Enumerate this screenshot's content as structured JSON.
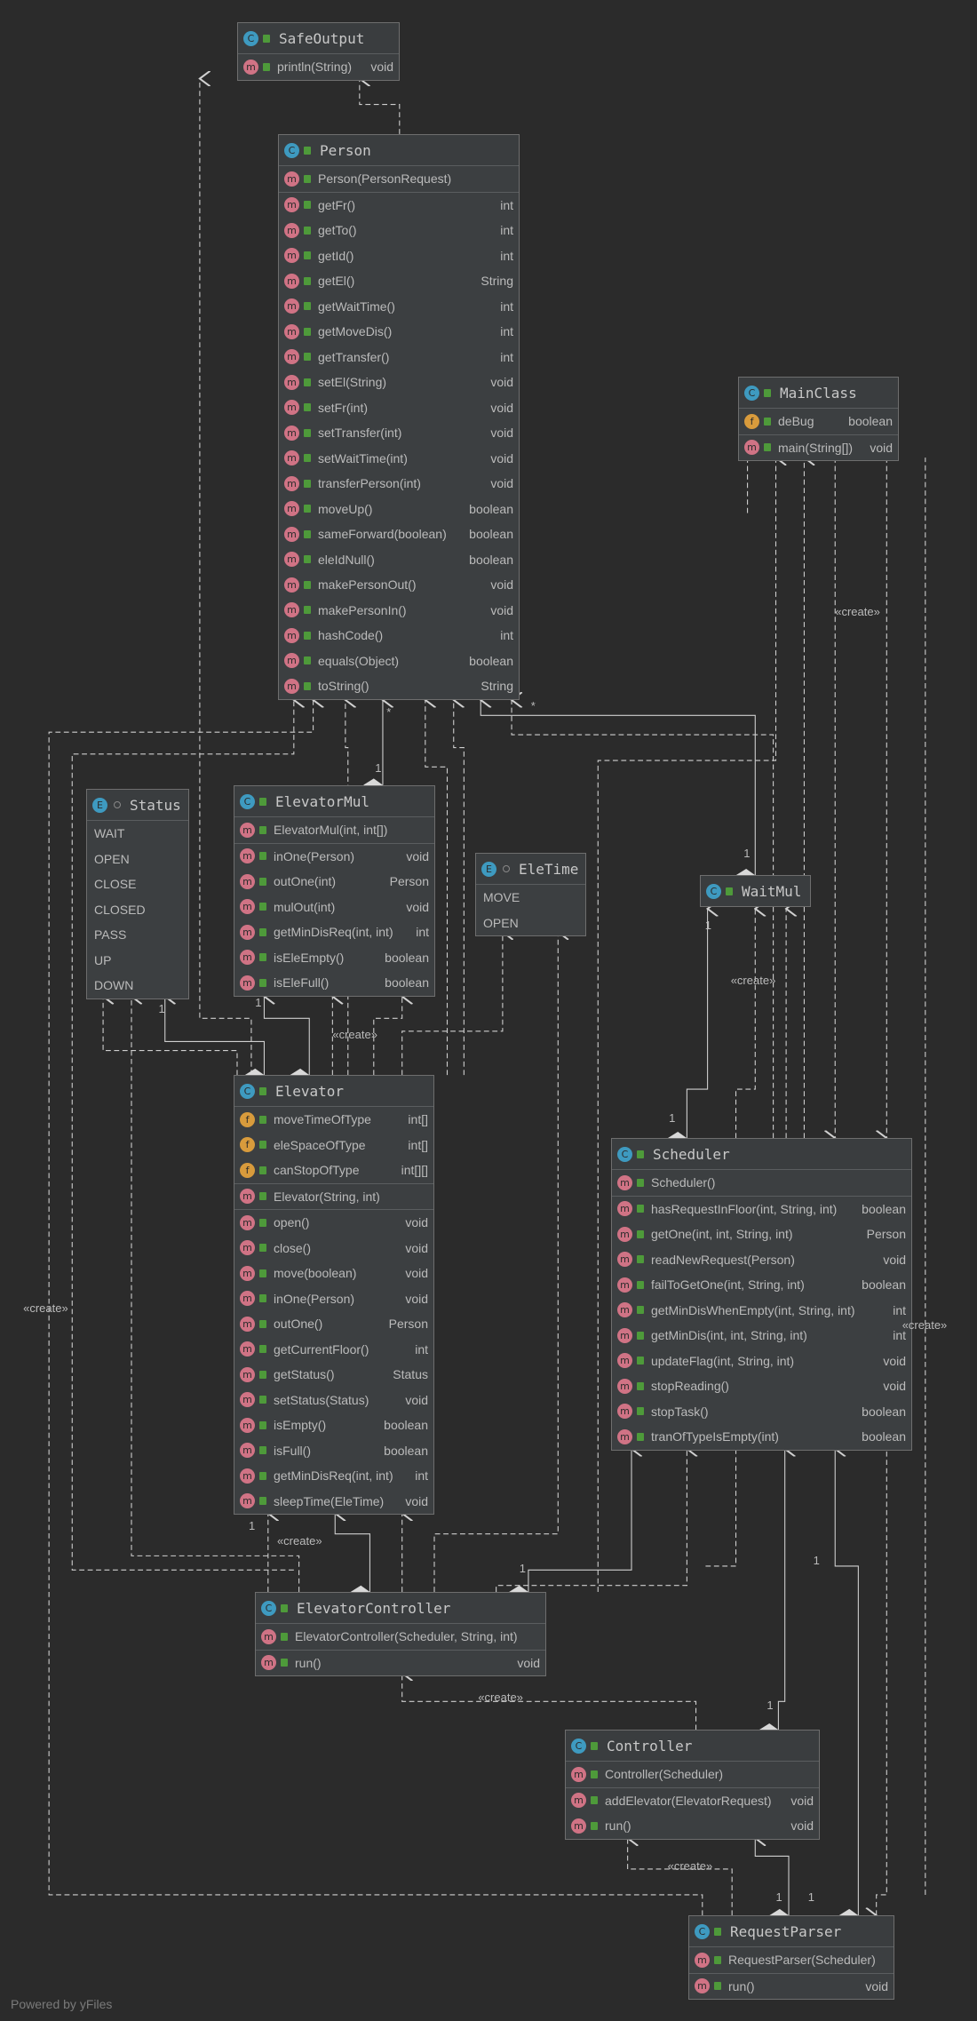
{
  "footer": "Powered by yFiles",
  "colors": {
    "background": "#2b2b2b",
    "box": "#3c3f41",
    "class_icon": "#3e9ac0",
    "method_icon": "#d07385",
    "field_icon": "#d89b3c",
    "public_lock": "#4e9a3a"
  },
  "classes": [
    {
      "name": "SafeOutput",
      "kind": "class",
      "sections": [
        [
          [
            "m",
            "println(String)",
            "void"
          ]
        ]
      ]
    },
    {
      "name": "Person",
      "kind": "class",
      "sections": [
        [
          [
            "m",
            "Person(PersonRequest)",
            ""
          ]
        ],
        [
          [
            "m",
            "getFr()",
            "int"
          ],
          [
            "m",
            "getTo()",
            "int"
          ],
          [
            "m",
            "getId()",
            "int"
          ],
          [
            "m",
            "getEl()",
            "String"
          ],
          [
            "m",
            "getWaitTime()",
            "int"
          ],
          [
            "m",
            "getMoveDis()",
            "int"
          ],
          [
            "m",
            "getTransfer()",
            "int"
          ],
          [
            "m",
            "setEl(String)",
            "void"
          ],
          [
            "m",
            "setFr(int)",
            "void"
          ],
          [
            "m",
            "setTransfer(int)",
            "void"
          ],
          [
            "m",
            "setWaitTime(int)",
            "void"
          ],
          [
            "m",
            "transferPerson(int)",
            "void"
          ],
          [
            "m",
            "moveUp()",
            "boolean"
          ],
          [
            "m",
            "sameForward(boolean)",
            "boolean"
          ],
          [
            "m",
            "eleIdNull()",
            "boolean"
          ],
          [
            "m",
            "makePersonOut()",
            "void"
          ],
          [
            "m",
            "makePersonIn()",
            "void"
          ],
          [
            "m",
            "hashCode()",
            "int"
          ],
          [
            "m",
            "equals(Object)",
            "boolean"
          ],
          [
            "m",
            "toString()",
            "String"
          ]
        ]
      ]
    },
    {
      "name": "MainClass",
      "kind": "class",
      "sections": [
        [
          [
            "f",
            "deBug",
            "boolean"
          ]
        ],
        [
          [
            "m",
            "main(String[])",
            "void"
          ]
        ]
      ]
    },
    {
      "name": "Status",
      "kind": "enum",
      "sections": [
        [
          [
            "",
            "WAIT",
            ""
          ],
          [
            "",
            "OPEN",
            ""
          ],
          [
            "",
            "CLOSE",
            ""
          ],
          [
            "",
            "CLOSED",
            ""
          ],
          [
            "",
            "PASS",
            ""
          ],
          [
            "",
            "UP",
            ""
          ],
          [
            "",
            "DOWN",
            ""
          ]
        ]
      ]
    },
    {
      "name": "ElevatorMul",
      "kind": "class",
      "sections": [
        [
          [
            "m",
            "ElevatorMul(int, int[])",
            ""
          ]
        ],
        [
          [
            "m",
            "inOne(Person)",
            "void"
          ],
          [
            "m",
            "outOne(int)",
            "Person"
          ],
          [
            "m",
            "mulOut(int)",
            "void"
          ],
          [
            "m",
            "getMinDisReq(int, int)",
            "int"
          ],
          [
            "m",
            "isEleEmpty()",
            "boolean"
          ],
          [
            "m",
            "isEleFull()",
            "boolean"
          ]
        ]
      ]
    },
    {
      "name": "EleTime",
      "kind": "enum",
      "sections": [
        [
          [
            "",
            "MOVE",
            ""
          ],
          [
            "",
            "OPEN",
            ""
          ]
        ]
      ]
    },
    {
      "name": "WaitMul",
      "kind": "class",
      "sections": []
    },
    {
      "name": "Elevator",
      "kind": "class",
      "sections": [
        [
          [
            "f",
            "moveTimeOfType",
            "int[]"
          ],
          [
            "f",
            "eleSpaceOfType",
            "int[]"
          ],
          [
            "f",
            "canStopOfType",
            "int[][]"
          ]
        ],
        [
          [
            "m",
            "Elevator(String, int)",
            ""
          ]
        ],
        [
          [
            "m",
            "open()",
            "void"
          ],
          [
            "m",
            "close()",
            "void"
          ],
          [
            "m",
            "move(boolean)",
            "void"
          ],
          [
            "m",
            "inOne(Person)",
            "void"
          ],
          [
            "m",
            "outOne()",
            "Person"
          ],
          [
            "m",
            "getCurrentFloor()",
            "int"
          ],
          [
            "m",
            "getStatus()",
            "Status"
          ],
          [
            "m",
            "setStatus(Status)",
            "void"
          ],
          [
            "m",
            "isEmpty()",
            "boolean"
          ],
          [
            "m",
            "isFull()",
            "boolean"
          ],
          [
            "m",
            "getMinDisReq(int, int)",
            "int"
          ],
          [
            "m",
            "sleepTime(EleTime)",
            "void"
          ]
        ]
      ]
    },
    {
      "name": "Scheduler",
      "kind": "class",
      "sections": [
        [
          [
            "m",
            "Scheduler()",
            ""
          ]
        ],
        [
          [
            "m",
            "hasRequestInFloor(int, String, int)",
            "boolean"
          ],
          [
            "m",
            "getOne(int, int, String, int)",
            "Person"
          ],
          [
            "m",
            "readNewRequest(Person)",
            "void"
          ],
          [
            "m",
            "failToGetOne(int, String, int)",
            "boolean"
          ],
          [
            "m",
            "getMinDisWhenEmpty(int, String, int)",
            "int"
          ],
          [
            "m",
            "getMinDis(int, int, String, int)",
            "int"
          ],
          [
            "m",
            "updateFlag(int, String, int)",
            "void"
          ],
          [
            "m",
            "stopReading()",
            "void"
          ],
          [
            "m",
            "stopTask()",
            "boolean"
          ],
          [
            "m",
            "tranOfTypeIsEmpty(int)",
            "boolean"
          ]
        ]
      ]
    },
    {
      "name": "ElevatorController",
      "kind": "class",
      "sections": [
        [
          [
            "m",
            "ElevatorController(Scheduler, String, int)",
            ""
          ]
        ],
        [
          [
            "m",
            "run()",
            "void"
          ]
        ]
      ]
    },
    {
      "name": "Controller",
      "kind": "class",
      "sections": [
        [
          [
            "m",
            "Controller(Scheduler)",
            ""
          ]
        ],
        [
          [
            "m",
            "addElevator(ElevatorRequest)",
            "void"
          ],
          [
            "m",
            "run()",
            "void"
          ]
        ]
      ]
    },
    {
      "name": "RequestParser",
      "kind": "class",
      "sections": [
        [
          [
            "m",
            "RequestParser(Scheduler)",
            ""
          ]
        ],
        [
          [
            "m",
            "run()",
            "void"
          ]
        ]
      ]
    }
  ],
  "edge_labels": [
    "«create»",
    "«create»",
    "«create»",
    "«create»",
    "«create»",
    "«create»",
    "«create»",
    "«create»",
    "«create»",
    "1",
    "1",
    "1",
    "1",
    "1",
    "1",
    "1",
    "1",
    "1",
    "1",
    "1",
    "1",
    "*",
    "*"
  ]
}
